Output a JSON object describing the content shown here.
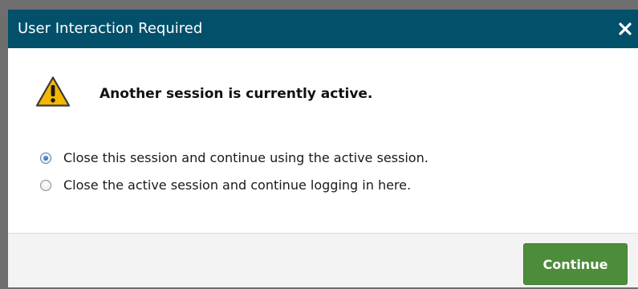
{
  "dialog": {
    "title": "User Interaction Required",
    "close_icon": "close-icon",
    "warning_icon": "warning-triangle-icon",
    "message": "Another session is currently active.",
    "options": [
      {
        "label": "Close this session and continue using the active session.",
        "selected": true
      },
      {
        "label": "Close the active session and continue logging in here.",
        "selected": false
      }
    ],
    "continue_label": "Continue"
  },
  "colors": {
    "titlebar": "#03506b",
    "button": "#4d8c3b",
    "warning": "#f5b800",
    "backdrop": "#6e6e6e"
  }
}
